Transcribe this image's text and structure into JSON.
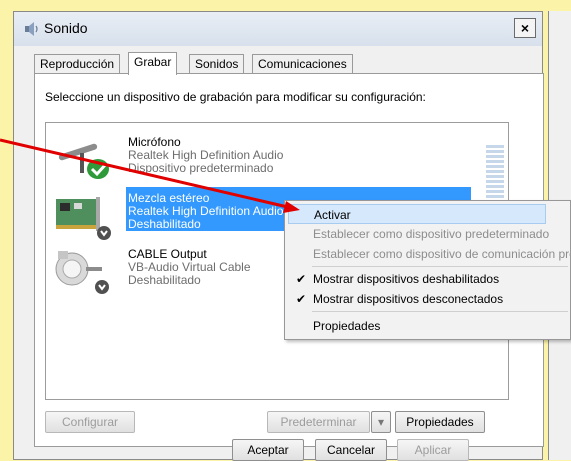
{
  "window": {
    "title": "Sonido",
    "close_label": "×"
  },
  "tabs": [
    {
      "label": "Reproducción",
      "active": false
    },
    {
      "label": "Grabar",
      "active": true
    },
    {
      "label": "Sonidos",
      "active": false
    },
    {
      "label": "Comunicaciones",
      "active": false
    }
  ],
  "instructions": "Seleccione un dispositivo de grabación para modificar su configuración:",
  "devices": [
    {
      "name": "Micrófono",
      "driver": "Realtek High Definition Audio",
      "status": "Dispositivo predeterminado",
      "icon": "microphone-icon",
      "selected": false
    },
    {
      "name": "Mezcla estéreo",
      "driver": "Realtek High Definition Audio",
      "status": "Deshabilitado",
      "icon": "sound-card-icon",
      "selected": true
    },
    {
      "name": "CABLE Output",
      "driver": "VB-Audio Virtual Cable",
      "status": "Deshabilitado",
      "icon": "cable-icon",
      "selected": false
    }
  ],
  "context_menu": {
    "items": [
      {
        "label": "Activar",
        "enabled": true,
        "checked": false,
        "highlighted": true
      },
      {
        "label": "Establecer como dispositivo predeterminado",
        "enabled": false,
        "checked": false
      },
      {
        "label": "Establecer como dispositivo de comunicación predeterminado",
        "enabled": false,
        "checked": false
      },
      {
        "label": "Mostrar dispositivos deshabilitados",
        "enabled": true,
        "checked": true
      },
      {
        "label": "Mostrar dispositivos desconectados",
        "enabled": true,
        "checked": true
      },
      {
        "label": "Propiedades",
        "enabled": true,
        "checked": false
      }
    ]
  },
  "buttons": {
    "configure": "Configurar",
    "set_default": "Predeterminar",
    "properties": "Propiedades",
    "ok": "Aceptar",
    "cancel": "Cancelar",
    "apply": "Aplicar"
  },
  "colors": {
    "background": "#fbf3a7",
    "selection": "#3399ff",
    "annotation_arrow": "#e00000"
  }
}
